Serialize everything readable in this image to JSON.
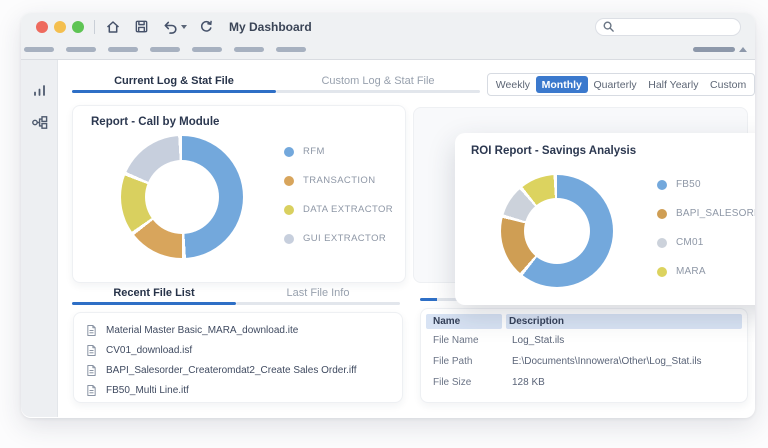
{
  "window": {
    "title": "My Dashboard",
    "search_placeholder": "",
    "traffic_lights": [
      "#ee6a5e",
      "#f4bf4f",
      "#5ec454"
    ]
  },
  "sidebar": {
    "items": [
      {
        "icon": "bar-chart-icon"
      },
      {
        "icon": "workflow-icon"
      }
    ]
  },
  "main_tabs": [
    {
      "label": "Current Log & Stat File",
      "active": true
    },
    {
      "label": "Custom Log & Stat File",
      "active": false
    }
  ],
  "period_tabs": [
    {
      "label": "Weekly",
      "active": false
    },
    {
      "label": "Monthly",
      "active": true
    },
    {
      "label": "Quarterly",
      "active": false
    },
    {
      "label": "Half Yearly",
      "active": false
    },
    {
      "label": "Custom",
      "active": false
    }
  ],
  "list_tabs": [
    {
      "label": "Recent File List",
      "active": true
    },
    {
      "label": "Last File Info",
      "active": false
    }
  ],
  "recent_files": [
    "Material Master Basic_MARA_download.ite",
    "CV01_download.isf",
    "BAPI_Salesorder_Createromdat2_Create Sales Order.iff",
    "FB50_Multi Line.itf"
  ],
  "file_info_table": {
    "headers": [
      "Name",
      "Description"
    ],
    "rows": [
      {
        "name": "File Name",
        "description": "Log_Stat.ils"
      },
      {
        "name": "File Path",
        "description": "E:\\Documents\\Innowera\\Other\\Log_Stat.ils"
      },
      {
        "name": "File Size",
        "description": "128 KB"
      }
    ]
  },
  "chart_data": [
    {
      "type": "pie",
      "variant": "donut",
      "title": "Report - Call by Module",
      "labels": [
        "RFM",
        "TRANSACTION",
        "DATA EXTRACTOR",
        "GUI EXTRACTOR"
      ],
      "values": [
        51,
        15,
        16,
        18
      ],
      "colors": [
        "#73a8dc",
        "#d8a55c",
        "#d9d05f",
        "#c7cfdd"
      ],
      "legend_position": "right"
    },
    {
      "type": "pie",
      "variant": "donut",
      "title": "ROI Report - Savings Analysis",
      "labels": [
        "FB50",
        "BAPI_SALESORDER_C..",
        "CM01",
        "MARA"
      ],
      "values": [
        63,
        18,
        9,
        10
      ],
      "colors": [
        "#73a8dc",
        "#cf9e54",
        "#ccd2db",
        "#dcd35f"
      ],
      "legend_position": "right"
    }
  ],
  "colors": {
    "accent_blue": "#2e6fc6",
    "active_button_blue": "#3b79cd",
    "table_header_bg": "#d8e3f4",
    "chrome_bg": "#eff1f3"
  }
}
